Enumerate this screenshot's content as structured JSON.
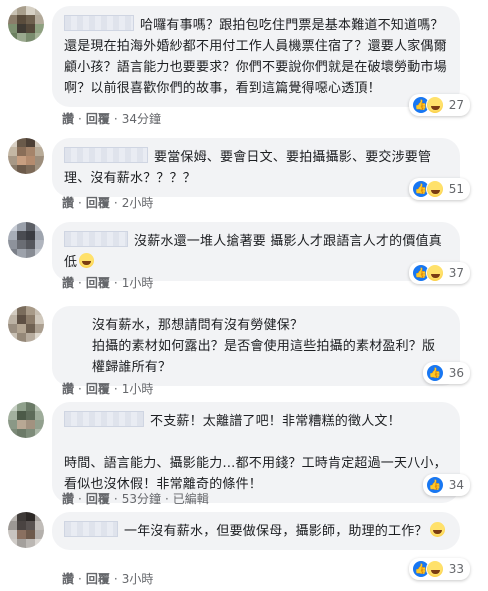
{
  "labels": {
    "like": "讚",
    "reply": "回覆",
    "edited": "已編輯",
    "sep": "·"
  },
  "comments": [
    {
      "text": "哈囉有事嗎？跟拍包吃住門票是基本難道不知道嗎？還是現在拍海外婚紗都不用付工作人員機票住宿了？還要人家偶爾顧小孩？語言能力也要要求？你們不要說你們就是在破壞勞動市場啊？以前很喜歡你們的故事，看到這篇覺得噁心透頂！",
      "time": "34分鐘",
      "reactions": [
        "like",
        "haha"
      ],
      "count": "27"
    },
    {
      "text": "要當保姆、要會日文、要拍攝攝影、要交涉要管理、沒有薪水？？？？",
      "time": "2小時",
      "reactions": [
        "like",
        "haha"
      ],
      "count": "51"
    },
    {
      "text": "沒薪水還一堆人搶著要 攝影人才跟語言人才的價值真低",
      "time": "1小時",
      "reactions": [
        "like",
        "haha"
      ],
      "count": "37"
    },
    {
      "text": "沒有薪水，那想請問有沒有勞健保？\n拍攝的素材如何露出？是否會使用這些拍攝的素材盈利？版權歸誰所有？",
      "time": "1小時",
      "reactions": [
        "like"
      ],
      "count": "36"
    },
    {
      "text": "不支薪！太離譜了吧！非常糟糕的徵人文！\n\n時間、語言能力、攝影能力…都不用錢？工時肯定超過一天八小，看似也沒休假！非常離奇的條件！",
      "time": "53分鐘",
      "edited": true,
      "reactions": [
        "like"
      ],
      "count": "34"
    },
    {
      "text": "一年沒有薪水，但要做保母，攝影師，助理的工作？",
      "time": "3小時",
      "reactions": [
        "like",
        "haha"
      ],
      "count": "33"
    }
  ]
}
